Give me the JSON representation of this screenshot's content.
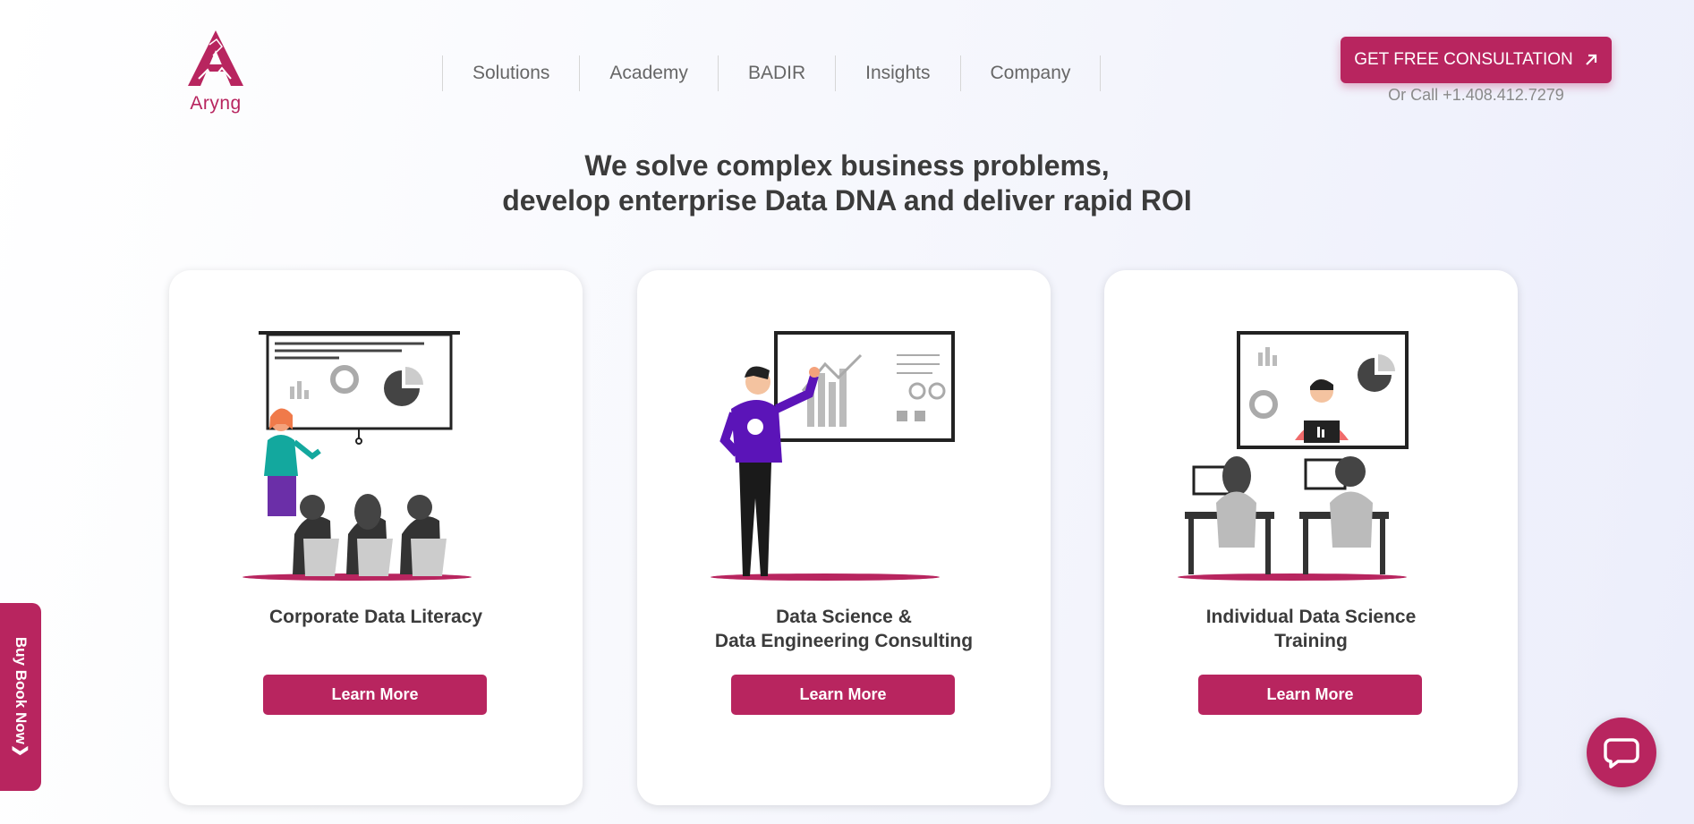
{
  "brand": {
    "logo_text": "Aryng",
    "accent_color": "#b8255f"
  },
  "nav": {
    "items": [
      {
        "label": "Solutions"
      },
      {
        "label": "Academy"
      },
      {
        "label": "BADIR"
      },
      {
        "label": "Insights"
      },
      {
        "label": "Company"
      }
    ]
  },
  "cta": {
    "label": "GET FREE CONSULTATION",
    "icon": "arrow-up-right-icon",
    "call_text": "Or Call +1.408.412.7279"
  },
  "hero": {
    "line1": "We solve complex business problems,",
    "line2": "develop enterprise Data DNA and deliver rapid ROI"
  },
  "cards": [
    {
      "title": "Corporate Data Literacy",
      "button": "Learn More",
      "illustration": "presenter-with-audience"
    },
    {
      "title": "Data Science &",
      "title2": "Data Engineering Consulting",
      "button": "Learn More",
      "illustration": "man-pointing-at-board"
    },
    {
      "title": "Individual Data Science",
      "title2": "Training",
      "button": "Learn More",
      "illustration": "online-training-classroom"
    }
  ],
  "side_tab": {
    "label": "Buy Book Now❯"
  },
  "chat": {
    "icon": "chat-bubble-icon"
  }
}
